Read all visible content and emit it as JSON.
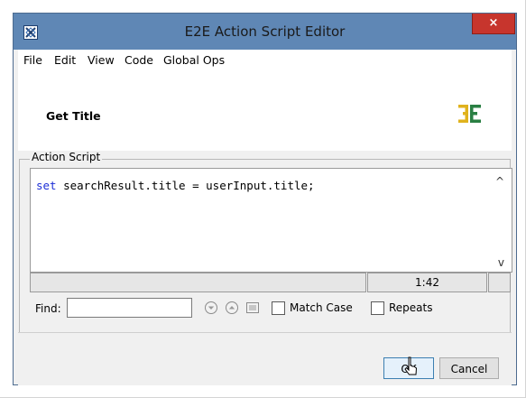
{
  "window": {
    "title": "E2E Action Script Editor",
    "close_glyph": "×"
  },
  "icons": {
    "app": "app-icon",
    "logo": "e2e-logo-icon",
    "find_next": "find-next-icon",
    "find_prev": "find-previous-icon",
    "find_all": "find-all-icon",
    "cursor": "mouse-cursor-icon"
  },
  "menu": {
    "items": [
      "File",
      "Edit",
      "View",
      "Code",
      "Global Ops"
    ]
  },
  "header": {
    "action_name": "Get Title"
  },
  "script": {
    "group_label": "Action Script",
    "keyword": "set",
    "code_rest": " searchResult.title = userInput.title;",
    "scroll_up": "^",
    "scroll_down": "v",
    "position": "1:42"
  },
  "find": {
    "label": "Find:",
    "value": "",
    "placeholder": "",
    "match_case_label": "Match Case",
    "match_case_checked": false,
    "repeats_label": "Repeats",
    "repeats_checked": false
  },
  "buttons": {
    "ok": "OK",
    "cancel": "Cancel"
  },
  "colors": {
    "titlebar": "#5f87b5",
    "close": "#c7352d",
    "keyword": "#1d2fd6",
    "logo_yellow": "#e0b21d",
    "logo_green": "#2a7f43"
  }
}
